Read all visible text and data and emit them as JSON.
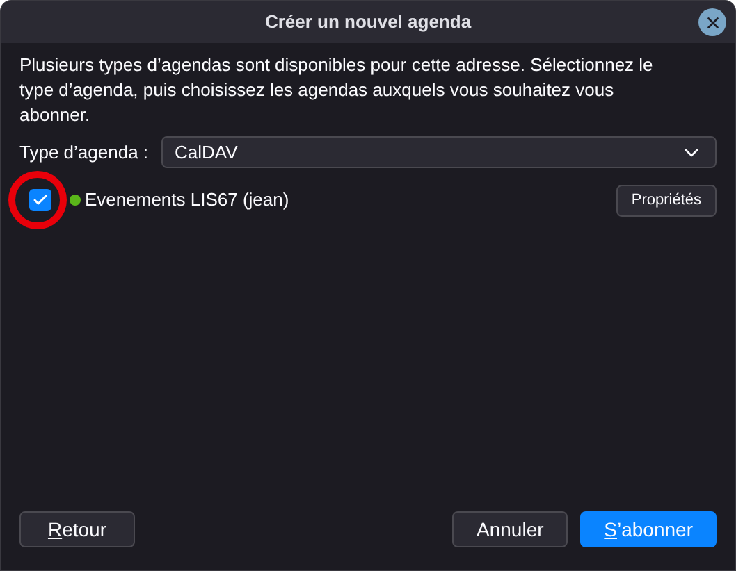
{
  "window": {
    "title": "Créer un nouvel agenda"
  },
  "intro": "Plusieurs types d’agendas sont disponibles pour cette adresse. Sélectionnez le type d’agenda, puis choisissez les agendas auxquels vous souhaitez vous abonner.",
  "calendar_type": {
    "label": "Type d’agenda :",
    "value": "CalDAV"
  },
  "calendars": [
    {
      "name": "Evenements LIS67 (jean)",
      "checked": true,
      "color": "#5ab61a",
      "properties_button": "Propriétés"
    }
  ],
  "buttons": [
    {
      "kind": "plain",
      "mnemonic": "R",
      "label_rest": "etour"
    },
    {
      "kind": "plain",
      "label": "Annuler"
    },
    {
      "kind": "primary",
      "mnemonic": "S",
      "label_rest": "’abonner"
    }
  ]
}
